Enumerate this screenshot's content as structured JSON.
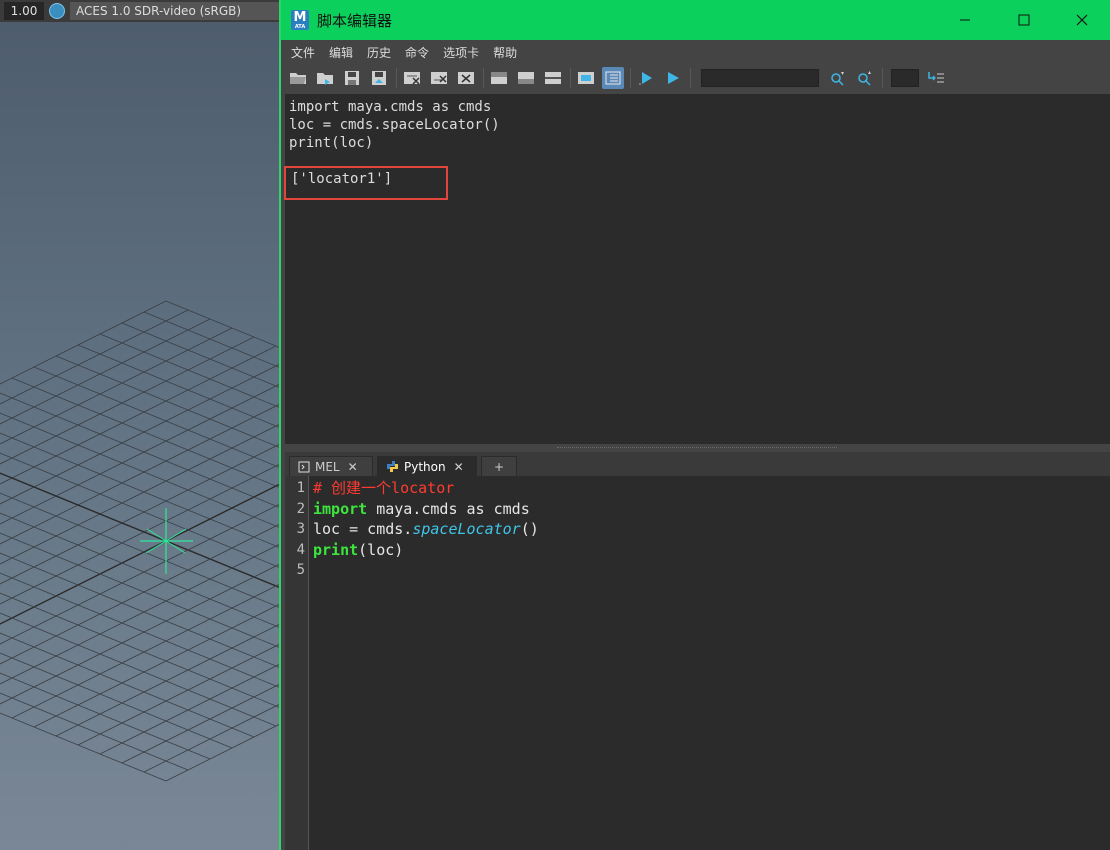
{
  "viewport": {
    "gamma": "1.00",
    "color_management_icon": "color-management-icon",
    "color_space": "ACES 1.0 SDR-video (sRGB)"
  },
  "window": {
    "title": "脚本编辑器",
    "app_icon": "maya-icon",
    "app_icon_letter": "M",
    "app_icon_sub": "ATA",
    "controls": [
      "minimize-icon",
      "maximize-icon",
      "close-icon"
    ]
  },
  "menu": [
    "文件",
    "编辑",
    "历史",
    "命令",
    "选项卡",
    "帮助"
  ],
  "toolbar": {
    "search_value": "",
    "small_field_value": ""
  },
  "output": {
    "lines": [
      "import maya.cmds as cmds",
      "loc = cmds.spaceLocator()",
      "print(loc)"
    ],
    "result": "['locator1']"
  },
  "tabs": [
    {
      "label": "MEL",
      "icon": "mel-icon",
      "active": false
    },
    {
      "label": "Python",
      "icon": "python-icon",
      "active": true
    },
    {
      "label": "+"
    }
  ],
  "editor": {
    "line_numbers": [
      "1",
      "2",
      "3",
      "4",
      "5"
    ],
    "comment": "# 创建一个locator",
    "line2": {
      "kw": "import",
      "rest": " maya.cmds as cmds"
    },
    "line3": {
      "pre": "loc = cmds.",
      "fn": "spaceLocator",
      "post": "()"
    },
    "line4": {
      "kw": "print",
      "rest": "(loc)"
    }
  },
  "colors": {
    "titlebar": "#0bd15c",
    "keyword": "#3ce63c",
    "comment": "#ff3b30",
    "function": "#3fc4e6",
    "highlight_box": "#e2453c",
    "locator": "#2ee89a"
  }
}
